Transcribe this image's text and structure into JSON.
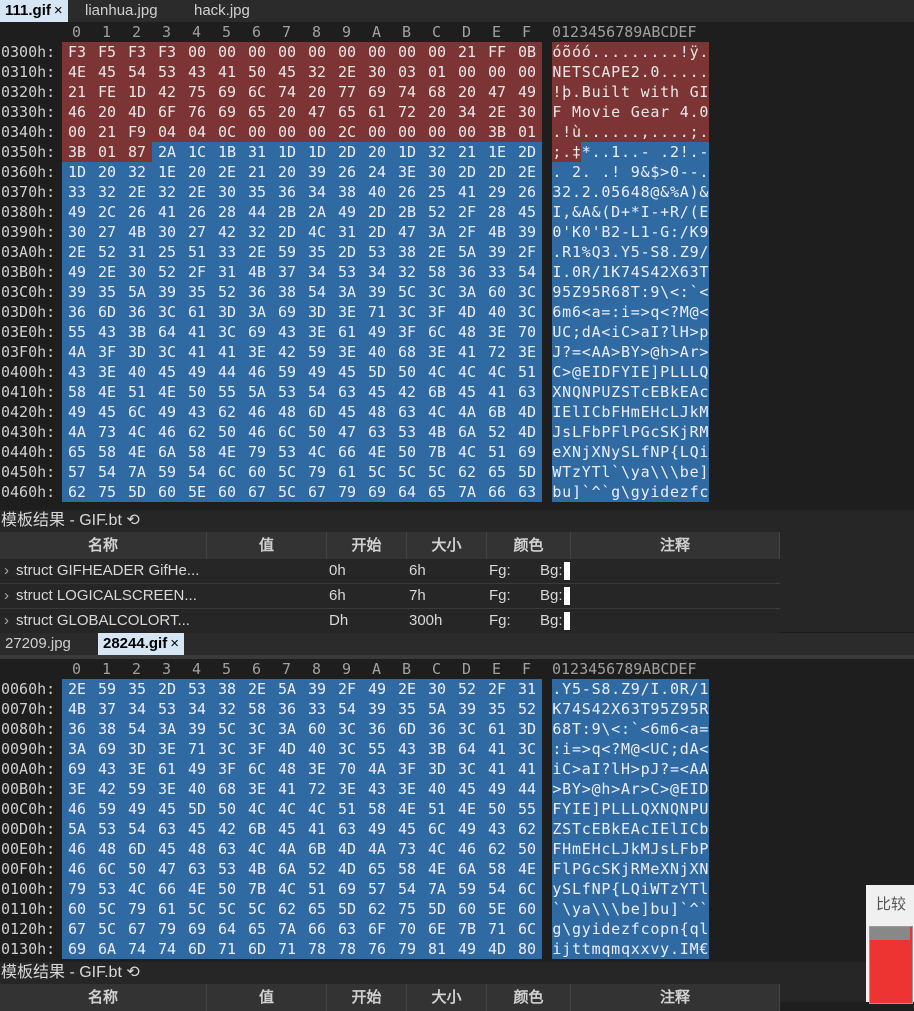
{
  "tabs_top": [
    {
      "label": "111.gif",
      "active": true,
      "close": "×"
    },
    {
      "label": "lianhua.jpg",
      "active": false
    },
    {
      "label": "hack.jpg",
      "active": false
    }
  ],
  "tabs_bottom": [
    {
      "label": "27209.jpg",
      "active": false
    },
    {
      "label": "28244.gif",
      "active": true,
      "close": "×"
    }
  ],
  "header": {
    "cols": [
      "0",
      "1",
      "2",
      "3",
      "4",
      "5",
      "6",
      "7",
      "8",
      "9",
      "A",
      "B",
      "C",
      "D",
      "E",
      "F"
    ],
    "ascii": "0123456789ABCDEF"
  },
  "editor1": {
    "rows": [
      {
        "addr": "0300h:",
        "bytes": [
          "F3",
          "F5",
          "F3",
          "F3",
          "00",
          "00",
          "00",
          "00",
          "00",
          "00",
          "00",
          "00",
          "00",
          "21",
          "FF",
          "0B"
        ],
        "ascii": "óõóó.........!ÿ.",
        "red": 16
      },
      {
        "addr": "0310h:",
        "bytes": [
          "4E",
          "45",
          "54",
          "53",
          "43",
          "41",
          "50",
          "45",
          "32",
          "2E",
          "30",
          "03",
          "01",
          "00",
          "00",
          "00"
        ],
        "ascii": "NETSCAPE2.0.....",
        "red": 16
      },
      {
        "addr": "0320h:",
        "bytes": [
          "21",
          "FE",
          "1D",
          "42",
          "75",
          "69",
          "6C",
          "74",
          "20",
          "77",
          "69",
          "74",
          "68",
          "20",
          "47",
          "49"
        ],
        "ascii": "!þ.Built with GI",
        "red": 16
      },
      {
        "addr": "0330h:",
        "bytes": [
          "46",
          "20",
          "4D",
          "6F",
          "76",
          "69",
          "65",
          "20",
          "47",
          "65",
          "61",
          "72",
          "20",
          "34",
          "2E",
          "30"
        ],
        "ascii": "F Movie Gear 4.0",
        "red": 16
      },
      {
        "addr": "0340h:",
        "bytes": [
          "00",
          "21",
          "F9",
          "04",
          "04",
          "0C",
          "00",
          "00",
          "00",
          "2C",
          "00",
          "00",
          "00",
          "00",
          "3B",
          "01"
        ],
        "ascii": ".!ù......,....;.",
        "red": 16
      },
      {
        "addr": "0350h:",
        "bytes": [
          "3B",
          "01",
          "87",
          "2A",
          "1C",
          "1B",
          "31",
          "1D",
          "1D",
          "2D",
          "20",
          "1D",
          "32",
          "21",
          "1E",
          "2D"
        ],
        "ascii": ";.‡*..1..- .2!.-",
        "red": 3
      },
      {
        "addr": "0360h:",
        "bytes": [
          "1D",
          "20",
          "32",
          "1E",
          "20",
          "2E",
          "21",
          "20",
          "39",
          "26",
          "24",
          "3E",
          "30",
          "2D",
          "2D",
          "2E"
        ],
        "ascii": ". 2. .! 9&$>0--.",
        "red": 0
      },
      {
        "addr": "0370h:",
        "bytes": [
          "33",
          "32",
          "2E",
          "32",
          "2E",
          "30",
          "35",
          "36",
          "34",
          "38",
          "40",
          "26",
          "25",
          "41",
          "29",
          "26"
        ],
        "ascii": "32.2.05648@&%A)&",
        "red": 0
      },
      {
        "addr": "0380h:",
        "bytes": [
          "49",
          "2C",
          "26",
          "41",
          "26",
          "28",
          "44",
          "2B",
          "2A",
          "49",
          "2D",
          "2B",
          "52",
          "2F",
          "28",
          "45"
        ],
        "ascii": "I,&A&(D+*I-+R/(E",
        "red": 0
      },
      {
        "addr": "0390h:",
        "bytes": [
          "30",
          "27",
          "4B",
          "30",
          "27",
          "42",
          "32",
          "2D",
          "4C",
          "31",
          "2D",
          "47",
          "3A",
          "2F",
          "4B",
          "39"
        ],
        "ascii": "0'K0'B2-L1-G:/K9",
        "red": 0
      },
      {
        "addr": "03A0h:",
        "bytes": [
          "2E",
          "52",
          "31",
          "25",
          "51",
          "33",
          "2E",
          "59",
          "35",
          "2D",
          "53",
          "38",
          "2E",
          "5A",
          "39",
          "2F"
        ],
        "ascii": ".R1%Q3.Y5-S8.Z9/",
        "red": 0
      },
      {
        "addr": "03B0h:",
        "bytes": [
          "49",
          "2E",
          "30",
          "52",
          "2F",
          "31",
          "4B",
          "37",
          "34",
          "53",
          "34",
          "32",
          "58",
          "36",
          "33",
          "54"
        ],
        "ascii": "I.0R/1K74S42X63T",
        "red": 0
      },
      {
        "addr": "03C0h:",
        "bytes": [
          "39",
          "35",
          "5A",
          "39",
          "35",
          "52",
          "36",
          "38",
          "54",
          "3A",
          "39",
          "5C",
          "3C",
          "3A",
          "60",
          "3C"
        ],
        "ascii": "95Z95R68T:9\\<:`<",
        "red": 0
      },
      {
        "addr": "03D0h:",
        "bytes": [
          "36",
          "6D",
          "36",
          "3C",
          "61",
          "3D",
          "3A",
          "69",
          "3D",
          "3E",
          "71",
          "3C",
          "3F",
          "4D",
          "40",
          "3C"
        ],
        "ascii": "6m6<a=:i=>q<?M@<",
        "red": 0
      },
      {
        "addr": "03E0h:",
        "bytes": [
          "55",
          "43",
          "3B",
          "64",
          "41",
          "3C",
          "69",
          "43",
          "3E",
          "61",
          "49",
          "3F",
          "6C",
          "48",
          "3E",
          "70"
        ],
        "ascii": "UC;dA<iC>aI?lH>p",
        "red": 0
      },
      {
        "addr": "03F0h:",
        "bytes": [
          "4A",
          "3F",
          "3D",
          "3C",
          "41",
          "41",
          "3E",
          "42",
          "59",
          "3E",
          "40",
          "68",
          "3E",
          "41",
          "72",
          "3E"
        ],
        "ascii": "J?=<AA>BY>@h>Ar>",
        "red": 0
      },
      {
        "addr": "0400h:",
        "bytes": [
          "43",
          "3E",
          "40",
          "45",
          "49",
          "44",
          "46",
          "59",
          "49",
          "45",
          "5D",
          "50",
          "4C",
          "4C",
          "4C",
          "51"
        ],
        "ascii": "C>@EIDFYIE]PLLLQ",
        "red": 0
      },
      {
        "addr": "0410h:",
        "bytes": [
          "58",
          "4E",
          "51",
          "4E",
          "50",
          "55",
          "5A",
          "53",
          "54",
          "63",
          "45",
          "42",
          "6B",
          "45",
          "41",
          "63"
        ],
        "ascii": "XNQNPUZSTcEBkEAc",
        "red": 0
      },
      {
        "addr": "0420h:",
        "bytes": [
          "49",
          "45",
          "6C",
          "49",
          "43",
          "62",
          "46",
          "48",
          "6D",
          "45",
          "48",
          "63",
          "4C",
          "4A",
          "6B",
          "4D"
        ],
        "ascii": "IElICbFHmEHcLJkM",
        "red": 0
      },
      {
        "addr": "0430h:",
        "bytes": [
          "4A",
          "73",
          "4C",
          "46",
          "62",
          "50",
          "46",
          "6C",
          "50",
          "47",
          "63",
          "53",
          "4B",
          "6A",
          "52",
          "4D"
        ],
        "ascii": "JsLFbPFlPGcSKjRM",
        "red": 0
      },
      {
        "addr": "0440h:",
        "bytes": [
          "65",
          "58",
          "4E",
          "6A",
          "58",
          "4E",
          "79",
          "53",
          "4C",
          "66",
          "4E",
          "50",
          "7B",
          "4C",
          "51",
          "69"
        ],
        "ascii": "eXNjXNySLfNP{LQi",
        "red": 0
      },
      {
        "addr": "0450h:",
        "bytes": [
          "57",
          "54",
          "7A",
          "59",
          "54",
          "6C",
          "60",
          "5C",
          "79",
          "61",
          "5C",
          "5C",
          "5C",
          "62",
          "65",
          "5D"
        ],
        "ascii": "WTzYTl`\\ya\\\\\\be]",
        "red": 0
      },
      {
        "addr": "0460h:",
        "bytes": [
          "62",
          "75",
          "5D",
          "60",
          "5E",
          "60",
          "67",
          "5C",
          "67",
          "79",
          "69",
          "64",
          "65",
          "7A",
          "66",
          "63"
        ],
        "ascii": "bu]`^`g\\gyidezfc",
        "red": 0
      }
    ]
  },
  "editor2": {
    "rows": [
      {
        "addr": "0060h:",
        "bytes": [
          "2E",
          "59",
          "35",
          "2D",
          "53",
          "38",
          "2E",
          "5A",
          "39",
          "2F",
          "49",
          "2E",
          "30",
          "52",
          "2F",
          "31"
        ],
        "ascii": ".Y5-S8.Z9/I.0R/1"
      },
      {
        "addr": "0070h:",
        "bytes": [
          "4B",
          "37",
          "34",
          "53",
          "34",
          "32",
          "58",
          "36",
          "33",
          "54",
          "39",
          "35",
          "5A",
          "39",
          "35",
          "52"
        ],
        "ascii": "K74S42X63T95Z95R"
      },
      {
        "addr": "0080h:",
        "bytes": [
          "36",
          "38",
          "54",
          "3A",
          "39",
          "5C",
          "3C",
          "3A",
          "60",
          "3C",
          "36",
          "6D",
          "36",
          "3C",
          "61",
          "3D"
        ],
        "ascii": "68T:9\\<:`<6m6<a="
      },
      {
        "addr": "0090h:",
        "bytes": [
          "3A",
          "69",
          "3D",
          "3E",
          "71",
          "3C",
          "3F",
          "4D",
          "40",
          "3C",
          "55",
          "43",
          "3B",
          "64",
          "41",
          "3C"
        ],
        "ascii": ":i=>q<?M@<UC;dA<"
      },
      {
        "addr": "00A0h:",
        "bytes": [
          "69",
          "43",
          "3E",
          "61",
          "49",
          "3F",
          "6C",
          "48",
          "3E",
          "70",
          "4A",
          "3F",
          "3D",
          "3C",
          "41",
          "41"
        ],
        "ascii": "iC>aI?lH>pJ?=<AA"
      },
      {
        "addr": "00B0h:",
        "bytes": [
          "3E",
          "42",
          "59",
          "3E",
          "40",
          "68",
          "3E",
          "41",
          "72",
          "3E",
          "43",
          "3E",
          "40",
          "45",
          "49",
          "44"
        ],
        "ascii": ">BY>@h>Ar>C>@EID"
      },
      {
        "addr": "00C0h:",
        "bytes": [
          "46",
          "59",
          "49",
          "45",
          "5D",
          "50",
          "4C",
          "4C",
          "4C",
          "51",
          "58",
          "4E",
          "51",
          "4E",
          "50",
          "55"
        ],
        "ascii": "FYIE]PLLLQXNQNPU"
      },
      {
        "addr": "00D0h:",
        "bytes": [
          "5A",
          "53",
          "54",
          "63",
          "45",
          "42",
          "6B",
          "45",
          "41",
          "63",
          "49",
          "45",
          "6C",
          "49",
          "43",
          "62"
        ],
        "ascii": "ZSTcEBkEAcIElICb"
      },
      {
        "addr": "00E0h:",
        "bytes": [
          "46",
          "48",
          "6D",
          "45",
          "48",
          "63",
          "4C",
          "4A",
          "6B",
          "4D",
          "4A",
          "73",
          "4C",
          "46",
          "62",
          "50"
        ],
        "ascii": "FHmEHcLJkMJsLFbP"
      },
      {
        "addr": "00F0h:",
        "bytes": [
          "46",
          "6C",
          "50",
          "47",
          "63",
          "53",
          "4B",
          "6A",
          "52",
          "4D",
          "65",
          "58",
          "4E",
          "6A",
          "58",
          "4E"
        ],
        "ascii": "FlPGcSKjRMeXNjXN"
      },
      {
        "addr": "0100h:",
        "bytes": [
          "79",
          "53",
          "4C",
          "66",
          "4E",
          "50",
          "7B",
          "4C",
          "51",
          "69",
          "57",
          "54",
          "7A",
          "59",
          "54",
          "6C"
        ],
        "ascii": "ySLfNP{LQiWTzYTl"
      },
      {
        "addr": "0110h:",
        "bytes": [
          "60",
          "5C",
          "79",
          "61",
          "5C",
          "5C",
          "5C",
          "62",
          "65",
          "5D",
          "62",
          "75",
          "5D",
          "60",
          "5E",
          "60"
        ],
        "ascii": "`\\ya\\\\\\be]bu]`^`"
      },
      {
        "addr": "0120h:",
        "bytes": [
          "67",
          "5C",
          "67",
          "79",
          "69",
          "64",
          "65",
          "7A",
          "66",
          "63",
          "6F",
          "70",
          "6E",
          "7B",
          "71",
          "6C"
        ],
        "ascii": "g\\gyidezfcopn{ql"
      },
      {
        "addr": "0130h:",
        "bytes": [
          "69",
          "6A",
          "74",
          "74",
          "6D",
          "71",
          "6D",
          "71",
          "78",
          "78",
          "76",
          "79",
          "81",
          "49",
          "4D",
          "80"
        ],
        "ascii": "ijttmqmqxxvy.IM€"
      }
    ]
  },
  "template1": {
    "title": "模板结果 - GIF.bt",
    "columns": [
      "名称",
      "值",
      "开始",
      "大小",
      "颜色",
      "注释"
    ],
    "rows": [
      {
        "name": "struct GIFHEADER GifHe...",
        "value": "",
        "start": "0h",
        "size": "6h",
        "fg": "Fg:",
        "bg": "Bg:"
      },
      {
        "name": "struct LOGICALSCREEN...",
        "value": "",
        "start": "6h",
        "size": "7h",
        "fg": "Fg:",
        "bg": "Bg:"
      },
      {
        "name": "struct GLOBALCOLORT...",
        "value": "",
        "start": "Dh",
        "size": "300h",
        "fg": "Fg:",
        "bg": "Bg:"
      }
    ]
  },
  "template2": {
    "title": "模板结果 - GIF.bt",
    "columns": [
      "名称",
      "值",
      "开始",
      "大小",
      "颜色",
      "注释"
    ]
  },
  "compare": {
    "label": "比较"
  },
  "colors": {
    "red": "#7d3434",
    "blue": "#2f6aa2",
    "bg": "#1e1e1e"
  }
}
